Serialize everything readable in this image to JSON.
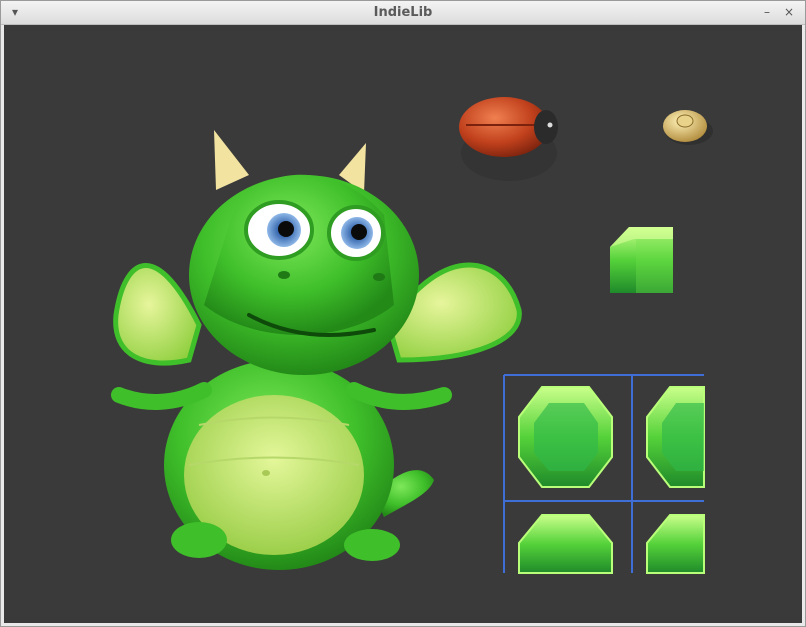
{
  "window": {
    "title": "IndieLib",
    "menu_icon": "chevron-down-icon",
    "minimize_icon": "minimize-icon",
    "close_icon": "close-icon"
  },
  "scene": {
    "background": "#3a3a3a",
    "grid_color": "#3f6fd6",
    "sprites": [
      "green-dragon-sprite",
      "red-beetle-sprite",
      "gold-ufo-sprite",
      "green-block-sprite",
      "green-gem-tile-sheet"
    ]
  }
}
